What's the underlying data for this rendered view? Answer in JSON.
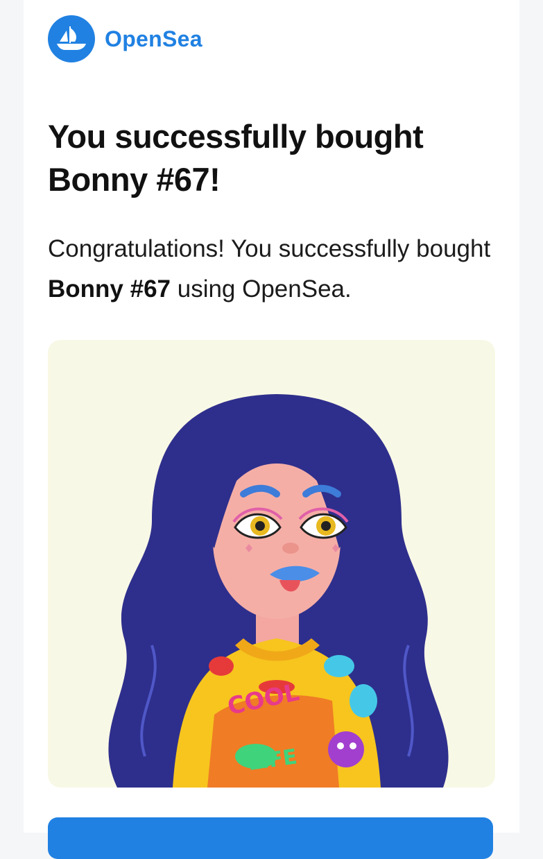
{
  "brand": {
    "name": "OpenSea",
    "color": "#2081e2"
  },
  "email": {
    "title": "You successfully bought Bonny #67!",
    "body_prefix": "Congratulations! You successfully bought ",
    "item_name": "Bonny #67",
    "body_suffix": " using OpenSea."
  },
  "nft": {
    "background": "#f8f8e6",
    "shirt_text_1": "COOL",
    "shirt_text_2": "LIFE"
  },
  "icons": {
    "logo": "opensea-boat-icon"
  }
}
